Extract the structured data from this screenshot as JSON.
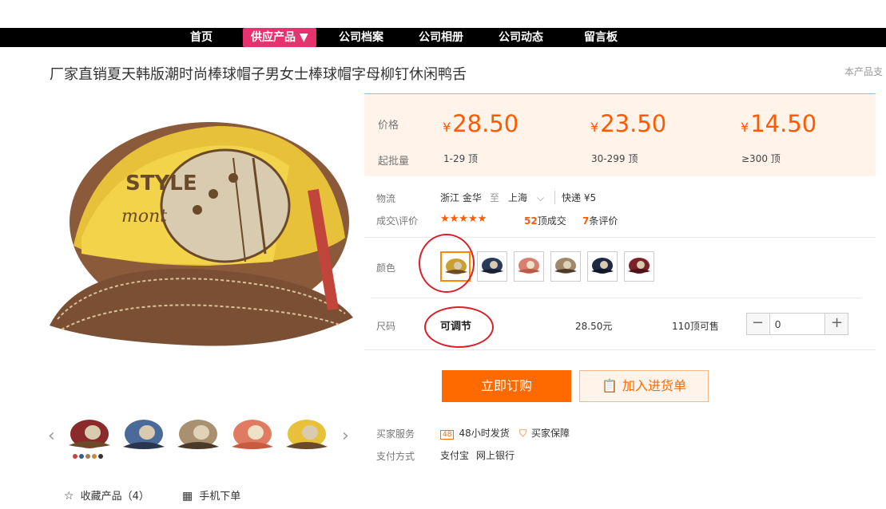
{
  "nav": {
    "items": [
      "首页",
      "供应产品 ▼",
      "公司档案",
      "公司相册",
      "公司动态",
      "留言板"
    ]
  },
  "product": {
    "title": "厂家直销夏天韩版潮时尚棒球帽子男女士棒球帽字母柳钉休闲鸭舌",
    "side_note": "本产品支"
  },
  "pricing": {
    "price_label": "价格",
    "moq_label": "起批量",
    "currency": "¥",
    "tiers": [
      {
        "price": "28.50",
        "qty": "1-29 顶"
      },
      {
        "price": "23.50",
        "qty": "30-299 顶"
      },
      {
        "price": "14.50",
        "qty": "≥300 顶"
      }
    ]
  },
  "logistics": {
    "label": "物流",
    "from": "浙江 金华",
    "to_word": "至",
    "to": "上海",
    "shipping": "快递 ¥5"
  },
  "deals": {
    "label": "成交\\评价",
    "stars": "★★★★★",
    "deal_count": "52",
    "deal_suffix": "顶成交",
    "review_count": "7",
    "review_suffix": "条评价"
  },
  "color": {
    "label": "颜色",
    "swatches": [
      "yellow",
      "navy",
      "pink",
      "khaki",
      "dark-blue",
      "burgundy"
    ]
  },
  "size": {
    "label": "尺码",
    "option": "可调节",
    "price": "28.50元",
    "stock": "110顶可售",
    "quantity": "0"
  },
  "actions": {
    "buy": "立即订购",
    "cart": "加入进货单"
  },
  "service": {
    "label": "买家服务",
    "item1_icon": "48",
    "item1": "48小时发货",
    "item2": "买家保障"
  },
  "payment": {
    "label": "支付方式",
    "item1": "支付宝",
    "item2": "网上银行"
  },
  "bottom": {
    "favorite": "收藏产品（4）",
    "mobile_order": "手机下单"
  },
  "colors": {
    "accent": "#ff6a00",
    "nav_active": "#e8316f",
    "annotation": "#d8202a"
  }
}
